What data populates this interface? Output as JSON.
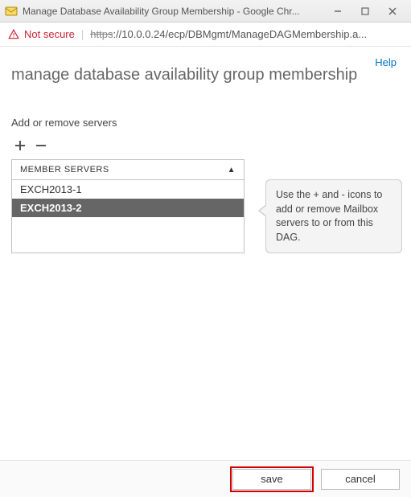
{
  "window": {
    "title": "Manage Database Availability Group Membership - Google Chr..."
  },
  "address_bar": {
    "not_secure_label": "Not secure",
    "protocol": "https",
    "rest": "://10.0.0.24/ecp/DBMgmt/ManageDAGMembership.a..."
  },
  "help_link": "Help",
  "page_title": "manage database availability group membership",
  "section_label": "Add or remove servers",
  "table": {
    "header": "MEMBER SERVERS",
    "rows": [
      {
        "name": "EXCH2013-1",
        "selected": false
      },
      {
        "name": "EXCH2013-2",
        "selected": true
      }
    ]
  },
  "callout_text": "Use the + and - icons to add or remove Mailbox servers to or from this DAG.",
  "buttons": {
    "save": "save",
    "cancel": "cancel"
  }
}
